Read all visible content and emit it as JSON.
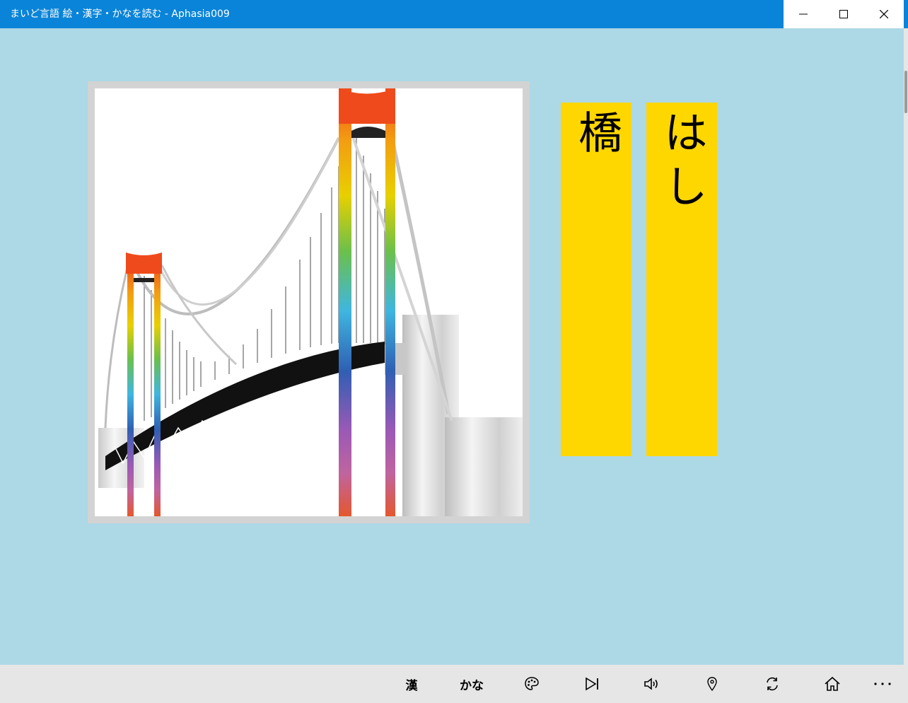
{
  "window": {
    "title": "まいど言語 絵・漢字・かなを読む - Aphasia009"
  },
  "picture": {
    "subject": "bridge"
  },
  "cards": {
    "kanji": "橋",
    "kana": "はし"
  },
  "appbar": {
    "kanji_label": "漢",
    "kana_label": "かな",
    "icons": [
      "palette-icon",
      "skip-next-icon",
      "volume-icon",
      "location-pin-icon",
      "refresh-icon",
      "home-icon",
      "more-icon"
    ],
    "more_label": "..."
  },
  "colors": {
    "background": "#add8e6",
    "card": "#ffd700",
    "titlebar": "#0a84d8",
    "appbar": "#e6e6e6"
  }
}
